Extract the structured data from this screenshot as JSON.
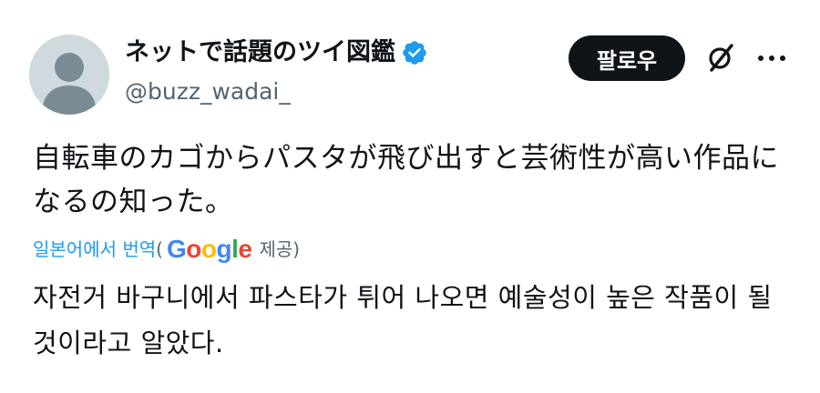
{
  "author": {
    "display_name": "ネットで話題のツイ図鑑",
    "handle": "@buzz_wadai_",
    "verified": true,
    "avatar_icon": "default-avatar-icon"
  },
  "actions": {
    "follow_label": "팔로우",
    "grok_icon": "grok-icon",
    "more_icon": "more-dots-icon"
  },
  "tweet": {
    "text": "自転車のカゴからパスタが飛び出すと芸術性が高い作品になるの知った。"
  },
  "translation": {
    "link_label": "일본어에서 번역",
    "open_paren": "(",
    "provider_letters": [
      "G",
      "o",
      "o",
      "g",
      "l",
      "e"
    ],
    "provided_label": "제공)",
    "text": "자전거 바구니에서 파스타가 튀어 나오면 예술성이 높은 작품이 될 것이라고 알았다."
  },
  "colors": {
    "link": "#1d9bf0",
    "verified": "#1d9bf0",
    "follow_bg": "#0f1419",
    "secondary_text": "#536471"
  }
}
